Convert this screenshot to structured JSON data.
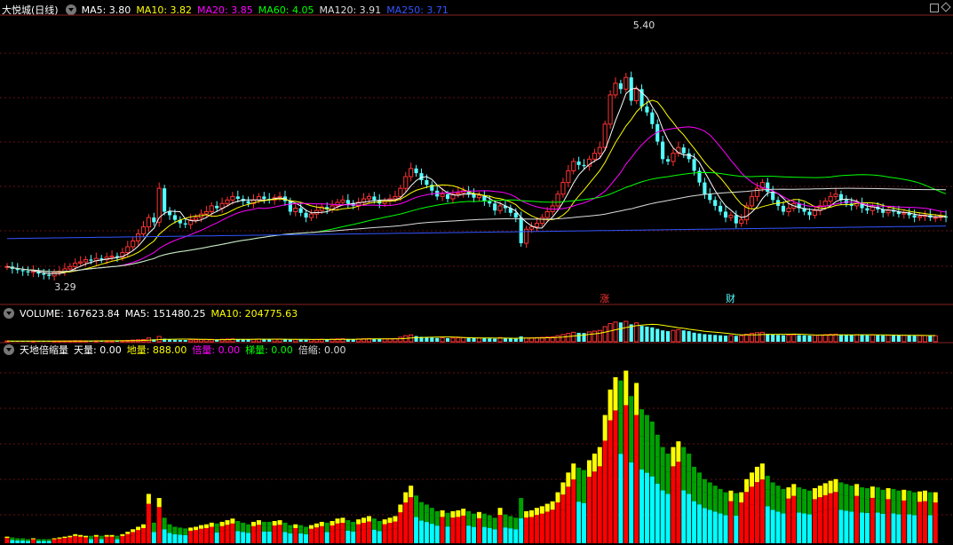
{
  "title": "大悦城(日线)",
  "main_ma": [
    {
      "label": "MA5: 3.80",
      "color": "#ffffff"
    },
    {
      "label": "MA10: 3.82",
      "color": "#ffff00"
    },
    {
      "label": "MA20: 3.85",
      "color": "#ff00ff"
    },
    {
      "label": "MA60: 4.05",
      "color": "#00ff00"
    },
    {
      "label": "MA120: 3.91",
      "color": "#dddddd"
    },
    {
      "label": "MA250: 3.71",
      "color": "#3355ff"
    }
  ],
  "annotations": {
    "high": "5.40",
    "low": "3.29",
    "mark1": "涨",
    "mark2": "财"
  },
  "volume_header": {
    "volume": "VOLUME: 167623.84",
    "ma5": "MA5: 151480.25",
    "ma10": "MA10: 204775.63"
  },
  "indicator_header": {
    "name": "天地倍缩量",
    "tian": "天量: 0.00",
    "di": "地量: 888.00",
    "bei": "倍量: 0.00",
    "ti": "梯量: 0.00",
    "suo": "倍缩: 0.00"
  },
  "colors": {
    "up": "#ff3232",
    "down": "#54ffff",
    "cyan": "#00ffff",
    "yellow": "#ffff00",
    "green": "#00a000",
    "red": "#ff0000"
  },
  "chart_data": [
    {
      "type": "candlestick",
      "title": "大悦城(日线)",
      "ylim": [
        3.2,
        5.45
      ],
      "x": [
        0,
        1,
        2,
        3,
        4,
        5,
        6,
        7,
        8,
        9,
        10,
        11,
        12,
        13,
        14,
        15,
        16,
        17,
        18,
        19,
        20,
        21,
        22,
        23,
        24,
        25,
        26,
        27,
        28,
        29,
        30,
        31,
        32,
        33,
        34,
        35,
        36,
        37,
        38,
        39,
        40,
        41,
        42,
        43,
        44,
        45,
        46,
        47,
        48,
        49,
        50,
        51,
        52,
        53,
        54,
        55,
        56,
        57,
        58,
        59,
        60,
        61,
        62,
        63,
        64,
        65,
        66,
        67,
        68,
        69,
        70,
        71,
        72,
        73,
        74,
        75,
        76,
        77,
        78,
        79,
        80,
        81,
        82,
        83,
        84,
        85,
        86,
        87,
        88,
        89,
        90,
        91,
        92,
        93,
        94,
        95,
        96,
        97,
        98,
        99,
        100,
        101,
        102,
        103,
        104,
        105,
        106,
        107,
        108,
        109,
        110,
        111,
        112,
        113,
        114,
        115,
        116,
        117,
        118,
        119,
        120,
        121,
        122,
        123,
        124,
        125,
        126,
        127,
        128,
        129,
        130,
        131,
        132,
        133,
        134,
        135,
        136,
        137,
        138,
        139,
        140,
        141,
        142,
        143,
        144,
        145,
        146,
        147,
        148,
        149,
        150,
        151,
        152,
        153,
        154,
        155,
        156,
        157,
        158,
        159,
        160,
        161,
        162,
        163,
        164,
        165,
        166,
        167,
        168,
        169,
        170,
        171,
        172,
        173,
        174,
        175,
        176,
        177
      ],
      "close": [
        3.38,
        3.36,
        3.35,
        3.34,
        3.33,
        3.34,
        3.32,
        3.31,
        3.3,
        3.33,
        3.34,
        3.36,
        3.38,
        3.41,
        3.42,
        3.44,
        3.43,
        3.45,
        3.44,
        3.46,
        3.47,
        3.46,
        3.5,
        3.55,
        3.6,
        3.66,
        3.72,
        3.8,
        3.76,
        4.05,
        3.85,
        3.82,
        3.78,
        3.75,
        3.74,
        3.78,
        3.8,
        3.83,
        3.85,
        3.9,
        3.88,
        3.92,
        3.95,
        3.98,
        3.96,
        3.94,
        3.92,
        3.95,
        3.98,
        3.96,
        3.95,
        3.97,
        3.98,
        3.94,
        3.85,
        3.88,
        3.84,
        3.8,
        3.83,
        3.86,
        3.89,
        3.87,
        3.9,
        3.93,
        3.95,
        3.92,
        3.9,
        3.93,
        3.96,
        3.98,
        3.95,
        3.92,
        3.94,
        3.96,
        3.98,
        4.05,
        4.15,
        4.22,
        4.18,
        4.12,
        4.08,
        4.03,
        3.98,
        4.0,
        3.96,
        4.0,
        4.01,
        4.03,
        4.0,
        3.97,
        3.99,
        3.94,
        3.92,
        3.86,
        3.9,
        3.88,
        3.84,
        3.8,
        3.58,
        3.7,
        3.72,
        3.75,
        3.8,
        3.85,
        3.9,
        4.0,
        4.1,
        4.2,
        4.28,
        4.25,
        4.24,
        4.3,
        4.35,
        4.4,
        4.6,
        4.85,
        4.95,
        4.9,
        5.0,
        4.8,
        4.9,
        4.75,
        4.7,
        4.6,
        4.45,
        4.3,
        4.28,
        4.35,
        4.4,
        4.35,
        4.3,
        4.2,
        4.1,
        4.0,
        3.95,
        3.9,
        3.85,
        3.8,
        3.82,
        3.75,
        3.78,
        3.9,
        3.98,
        4.05,
        4.1,
        4.02,
        3.95,
        3.9,
        3.85,
        3.88,
        3.92,
        3.88,
        3.85,
        3.82,
        3.86,
        3.9,
        3.94,
        3.98,
        4.0,
        3.95,
        3.92,
        3.9,
        3.93,
        3.88,
        3.86,
        3.89,
        3.87,
        3.84,
        3.86,
        3.85,
        3.83,
        3.84,
        3.82,
        3.8,
        3.81,
        3.82,
        3.8,
        3.8,
        3.81,
        3.8
      ],
      "series": [
        {
          "name": "MA5",
          "color": "#ffffff"
        },
        {
          "name": "MA10",
          "color": "#ffff00"
        },
        {
          "name": "MA20",
          "color": "#ff00ff"
        },
        {
          "name": "MA60",
          "color": "#00ff00"
        },
        {
          "name": "MA120",
          "color": "#dddddd"
        },
        {
          "name": "MA250",
          "color": "#3355ff"
        }
      ]
    },
    {
      "type": "bar",
      "title": "VOLUME",
      "values": [
        10,
        9,
        8,
        8,
        7,
        8,
        7,
        7,
        6,
        8,
        9,
        10,
        11,
        14,
        13,
        12,
        12,
        13,
        12,
        13,
        13,
        12,
        14,
        18,
        22,
        26,
        30,
        50,
        32,
        70,
        40,
        30,
        26,
        24,
        23,
        25,
        26,
        28,
        29,
        32,
        31,
        33,
        36,
        38,
        35,
        32,
        30,
        33,
        36,
        34,
        33,
        35,
        36,
        32,
        28,
        30,
        28,
        26,
        29,
        31,
        33,
        32,
        35,
        38,
        40,
        36,
        34,
        37,
        40,
        42,
        38,
        35,
        37,
        40,
        42,
        60,
        80,
        90,
        75,
        65,
        60,
        55,
        50,
        52,
        48,
        50,
        52,
        54,
        50,
        47,
        49,
        46,
        44,
        40,
        55,
        45,
        42,
        40,
        70,
        50,
        52,
        55,
        58,
        62,
        66,
        80,
        95,
        110,
        125,
        118,
        115,
        130,
        140,
        150,
        200,
        240,
        260,
        255,
        270,
        230,
        250,
        210,
        200,
        190,
        170,
        150,
        140,
        150,
        160,
        150,
        140,
        120,
        110,
        100,
        95,
        90,
        85,
        80,
        82,
        78,
        80,
        100,
        110,
        120,
        125,
        105,
        95,
        90,
        85,
        88,
        92,
        88,
        85,
        82,
        86,
        90,
        94,
        98,
        100,
        95,
        92,
        90,
        93,
        88,
        86,
        89,
        87,
        84,
        86,
        85,
        83,
        84,
        82,
        80,
        81,
        82,
        80,
        80
      ]
    },
    {
      "type": "bar",
      "title": "天地倍缩量",
      "values": [
        8,
        7,
        6,
        6,
        5,
        6,
        5,
        5,
        5,
        6,
        7,
        8,
        9,
        11,
        10,
        9,
        9,
        10,
        9,
        10,
        10,
        9,
        11,
        14,
        17,
        20,
        23,
        60,
        25,
        55,
        31,
        23,
        20,
        19,
        18,
        19,
        20,
        22,
        23,
        25,
        24,
        26,
        28,
        30,
        27,
        25,
        23,
        26,
        28,
        26,
        26,
        27,
        28,
        25,
        22,
        23,
        22,
        20,
        22,
        24,
        26,
        25,
        27,
        30,
        31,
        28,
        26,
        29,
        31,
        33,
        30,
        27,
        29,
        31,
        33,
        47,
        62,
        70,
        58,
        50,
        47,
        43,
        39,
        40,
        37,
        39,
        40,
        42,
        39,
        36,
        38,
        36,
        34,
        31,
        43,
        35,
        33,
        31,
        55,
        39,
        40,
        43,
        45,
        48,
        51,
        62,
        74,
        86,
        97,
        92,
        89,
        101,
        109,
        117,
        156,
        187,
        202,
        198,
        210,
        179,
        195,
        163,
        156,
        148,
        132,
        117,
        109,
        117,
        124,
        117,
        109,
        93,
        86,
        78,
        74,
        70,
        66,
        62,
        64,
        61,
        62,
        78,
        86,
        93,
        97,
        82,
        74,
        70,
        66,
        68,
        72,
        68,
        66,
        64,
        67,
        70,
        73,
        76,
        78,
        74,
        72,
        70,
        72,
        68,
        67,
        69,
        68,
        65,
        67,
        66,
        64,
        65,
        64,
        62,
        63,
        64,
        62,
        62
      ]
    }
  ]
}
